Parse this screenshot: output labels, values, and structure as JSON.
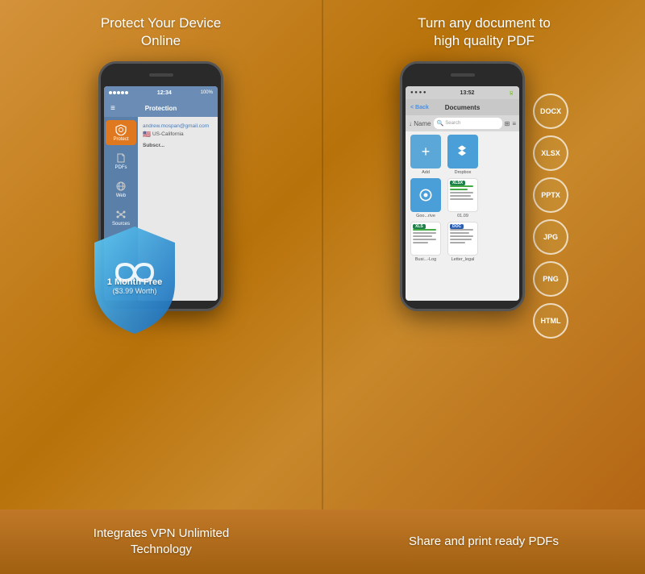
{
  "left_panel": {
    "title": "Protect Your Device\nOnline",
    "phone": {
      "status_time": "12:34",
      "status_battery": "100%",
      "nav_title": "Protection",
      "sidebar": [
        {
          "label": "Protect",
          "active": true
        },
        {
          "label": "PDFs",
          "active": false
        },
        {
          "label": "Web",
          "active": false
        },
        {
          "label": "Sources",
          "active": false
        }
      ],
      "user_email": "andrew.mospan@gmail.com",
      "user_location": "US-California",
      "subscribe_label": "Subscr..."
    },
    "vpn_shield": {
      "line1": "1 Month Free",
      "line2": "($3.99 Worth)"
    }
  },
  "right_panel": {
    "title": "Turn any document to\nhigh quality PDF",
    "phone": {
      "status_time": "13:52",
      "nav_title": "Documents",
      "back_label": "< Back",
      "toolbar": {
        "sort_label": "↓ Name",
        "search_placeholder": "Search",
        "grid_icon": "⊞",
        "list_icon": "≡"
      },
      "documents": [
        {
          "type": "add",
          "label": "Add"
        },
        {
          "type": "dropbox",
          "label": "Dropbox"
        },
        {
          "type": "gdrive",
          "label": "Goo...rive"
        },
        {
          "type": "xlsx",
          "label": "01.09"
        },
        {
          "type": "xls",
          "label": "Busi...-Log"
        },
        {
          "type": "doc",
          "label": "Letter_legal"
        }
      ]
    },
    "format_badges": [
      "DOCX",
      "XLSX",
      "PPTX",
      "JPG",
      "PNG",
      "HTML"
    ]
  },
  "bottom_left": {
    "text": "Integrates VPN Unlimited\nTechnology"
  },
  "bottom_right": {
    "text": "Share and print ready PDFs"
  }
}
